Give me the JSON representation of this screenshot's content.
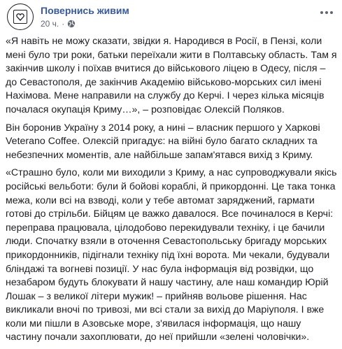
{
  "post": {
    "page_name": "Повернись живим",
    "timestamp": "20 ч.",
    "separator": "·",
    "audience_icon": "globe-icon",
    "paragraphs": [
      "«Я навіть не можу сказати, звідки я. Народився в Росії, в Пензі, коли мені було три роки, батьки переїхали жити в Полтавську область. Там я закінчив школу і поїхав вчитися до військового ліцею в Одесу, після – до Севастополя, де закінчив Академію військово-морських сил імені Нахімова. Мене направили на службу до Керчі. І через кілька місяців почалася окупація Криму…», – розповідає Олексій Поляков.",
      "Він боронив Україну з 2014 року, а нині – власник першого у Харкові Veterano Coffee. Олексій пригадує: на війні було багато складних та небезпечних моментів, але найбільше запам'ятався вихід з Криму.",
      "«Страшно було, коли ми виходили з Криму, а нас супроводжували якісь російські вельботи: були й бойові кораблі, й прикордонні. Це така тонка межа, коли всі на взводі, коли у тебе автомат заряджений, гармати готові до стрільби. Бійцям це важко давалося. Все починалося в Керчі: переправа працювала, цілодобово перекидували техніку, і це бачили люди. Спочатку взяли в оточення Севастопольську бригаду морських прикордонників, підігнали техніку під їхні ворота. Ми чекали, будували бліндажі та вогневі позиції. У нас була інформація від розвідки, що незабаром будуть блокувати й нашу частину, але наш командир Юрій Лошак – з великої літери мужик! – прийняв вольове рішення. Нас викликали вночі по тривозі, ми всі стали за вихід до Маріуполя. І вже коли ми пішли в Азовське море, з'явилася інформація, що нашу частину почали захоплювати, до неї прийшли «зелені чоловічки»."
    ]
  }
}
